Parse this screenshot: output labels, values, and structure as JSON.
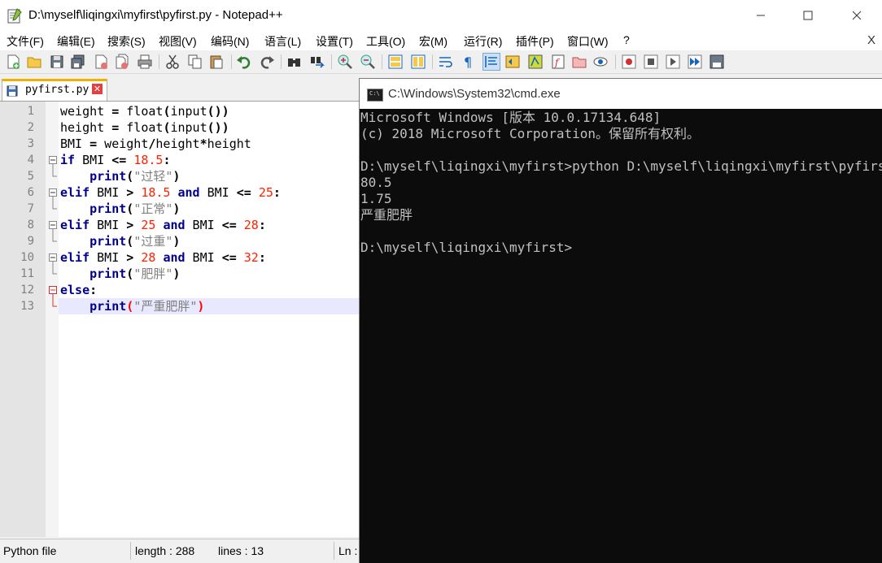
{
  "npp": {
    "title": "D:\\myself\\liqingxi\\myfirst\\pyfirst.py - Notepad++",
    "menu": [
      "文件(F)",
      "编辑(E)",
      "搜索(S)",
      "视图(V)",
      "编码(N)",
      "语言(L)",
      "设置(T)",
      "工具(O)",
      "宏(M)",
      "运行(R)",
      "插件(P)",
      "窗口(W)",
      "?"
    ],
    "menu_close": "X",
    "tab_label": "pyfirst.py",
    "status": {
      "file_type": "Python file",
      "length": "length : 288",
      "lines": "lines : 13",
      "ln": "Ln :"
    },
    "line_numbers": [
      "1",
      "2",
      "3",
      "4",
      "5",
      "6",
      "7",
      "8",
      "9",
      "10",
      "11",
      "12",
      "13"
    ]
  },
  "code": {
    "l1a": "weight ",
    "l1b": "=",
    "l1c": " float",
    "l1d": "(",
    "l1e": "input",
    "l1f": "())",
    "l2a": "height ",
    "l2b": "=",
    "l2c": " float",
    "l2d": "(",
    "l2e": "input",
    "l2f": "())",
    "l3a": "BMI ",
    "l3b": "=",
    "l3c": " weight",
    "l3d": "/",
    "l3e": "height",
    "l3f": "*",
    "l3g": "height",
    "l4a": "if",
    "l4b": " BMI ",
    "l4c": "<=",
    "l4d": " ",
    "l4e": "18.5",
    "l4f": ":",
    "l5a": "    ",
    "l5b": "print",
    "l5c": "(",
    "l5d": "\"过轻\"",
    "l5e": ")",
    "l6a": "elif",
    "l6b": " BMI ",
    "l6c": ">",
    "l6d": " ",
    "l6e": "18.5",
    "l6f": " ",
    "l6g": "and",
    "l6h": " BMI ",
    "l6i": "<=",
    "l6j": " ",
    "l6k": "25",
    "l6l": ":",
    "l7a": "    ",
    "l7b": "print",
    "l7c": "(",
    "l7d": "\"正常\"",
    "l7e": ")",
    "l8a": "elif",
    "l8b": " BMI ",
    "l8c": ">",
    "l8d": " ",
    "l8e": "25",
    "l8f": " ",
    "l8g": "and",
    "l8h": " BMI ",
    "l8i": "<=",
    "l8j": " ",
    "l8k": "28",
    "l8l": ":",
    "l9a": "    ",
    "l9b": "print",
    "l9c": "(",
    "l9d": "\"过重\"",
    "l9e": ")",
    "l10a": "elif",
    "l10b": " BMI ",
    "l10c": ">",
    "l10d": " ",
    "l10e": "28",
    "l10f": " ",
    "l10g": "and",
    "l10h": " BMI ",
    "l10i": "<=",
    "l10j": " ",
    "l10k": "32",
    "l10l": ":",
    "l11a": "    ",
    "l11b": "print",
    "l11c": "(",
    "l11d": "\"肥胖\"",
    "l11e": ")",
    "l12a": "else",
    "l12b": ":",
    "l13a": "    ",
    "l13b": "print",
    "l13c": "(",
    "l13d": "\"严重肥胖\"",
    "l13e": ")"
  },
  "cmd": {
    "title": "C:\\Windows\\System32\\cmd.exe",
    "icon_text": "C:\\",
    "lines": [
      "Microsoft Windows [版本 10.0.17134.648]",
      "(c) 2018 Microsoft Corporation。保留所有权利。",
      "",
      "D:\\myself\\liqingxi\\myfirst>python D:\\myself\\liqingxi\\myfirst\\pyfirst.py",
      "80.5",
      "1.75",
      "严重肥胖",
      "",
      "D:\\myself\\liqingxi\\myfirst>"
    ]
  },
  "colors": {
    "keyword": "#00008b",
    "number": "#ff2000",
    "string": "#808080",
    "tab_accent": "#f0b000",
    "current_line": "#e8e8ff",
    "console_bg": "#0c0c0c",
    "console_fg": "#c0c0c0"
  },
  "icons": [
    "notepadpp-icon",
    "new-file-icon",
    "open-file-icon",
    "save-icon",
    "save-all-icon",
    "close-icon",
    "close-all-icon",
    "print-icon",
    "cut-icon",
    "copy-icon",
    "paste-icon",
    "undo-icon",
    "redo-icon",
    "find-icon",
    "replace-icon",
    "zoom-in-icon",
    "zoom-out-icon",
    "sync-vertical-icon",
    "sync-horizontal-icon",
    "word-wrap-icon",
    "show-all-chars-icon",
    "indent-guide-icon",
    "udl-icon",
    "doc-map-icon",
    "function-list-icon",
    "folder-workspace-icon",
    "monitor-icon",
    "record-macro-icon",
    "stop-macro-icon",
    "play-macro-icon",
    "play-multiple-icon",
    "save-macro-icon",
    "cmd-icon",
    "minimize-icon",
    "maximize-icon",
    "close-window-icon"
  ]
}
